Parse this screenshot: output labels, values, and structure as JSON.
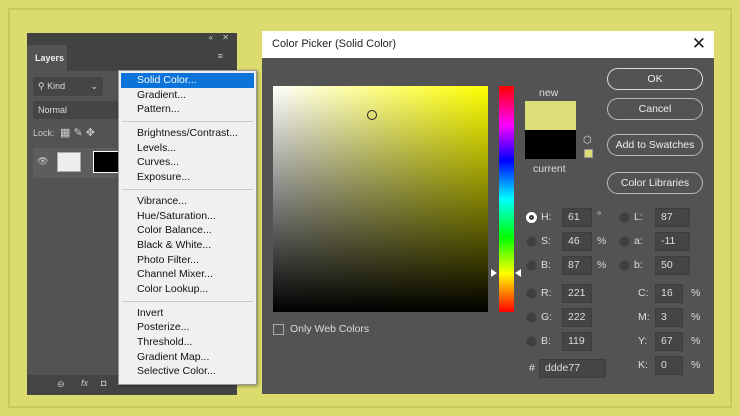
{
  "layers_panel": {
    "tab": "Layers",
    "filter": "Kind",
    "blend_mode": "Normal",
    "lock_label": "Lock:"
  },
  "menu": {
    "groups": [
      [
        "Solid Color...",
        "Gradient...",
        "Pattern..."
      ],
      [
        "Brightness/Contrast...",
        "Levels...",
        "Curves...",
        "Exposure..."
      ],
      [
        "Vibrance...",
        "Hue/Saturation...",
        "Color Balance...",
        "Black & White...",
        "Photo Filter...",
        "Channel Mixer...",
        "Color Lookup..."
      ],
      [
        "Invert",
        "Posterize...",
        "Threshold...",
        "Gradient Map...",
        "Selective Color..."
      ]
    ],
    "selected": "Solid Color..."
  },
  "dialog": {
    "title": "Color Picker (Solid Color)",
    "close": "✕",
    "new_label": "new",
    "current_label": "current",
    "buttons": {
      "ok": "OK",
      "cancel": "Cancel",
      "add": "Add to Swatches",
      "libraries": "Color Libraries"
    },
    "only_web": "Only Web Colors",
    "fields": {
      "H": {
        "label": "H:",
        "value": "61",
        "unit": "°"
      },
      "S": {
        "label": "S:",
        "value": "46",
        "unit": "%"
      },
      "Bv": {
        "label": "B:",
        "value": "87",
        "unit": "%"
      },
      "R": {
        "label": "R:",
        "value": "221"
      },
      "G": {
        "label": "G:",
        "value": "222"
      },
      "Bl": {
        "label": "B:",
        "value": "119"
      },
      "L": {
        "label": "L:",
        "value": "87"
      },
      "a": {
        "label": "a:",
        "value": "-11"
      },
      "b": {
        "label": "b:",
        "value": "50"
      },
      "C": {
        "label": "C:",
        "value": "16",
        "unit": "%"
      },
      "M": {
        "label": "M:",
        "value": "3",
        "unit": "%"
      },
      "Y": {
        "label": "Y:",
        "value": "67",
        "unit": "%"
      },
      "K": {
        "label": "K:",
        "value": "0",
        "unit": "%"
      }
    },
    "hex_label": "#",
    "hex": "ddde77",
    "colors": {
      "new": "#ddde77",
      "current": "#000000"
    }
  }
}
